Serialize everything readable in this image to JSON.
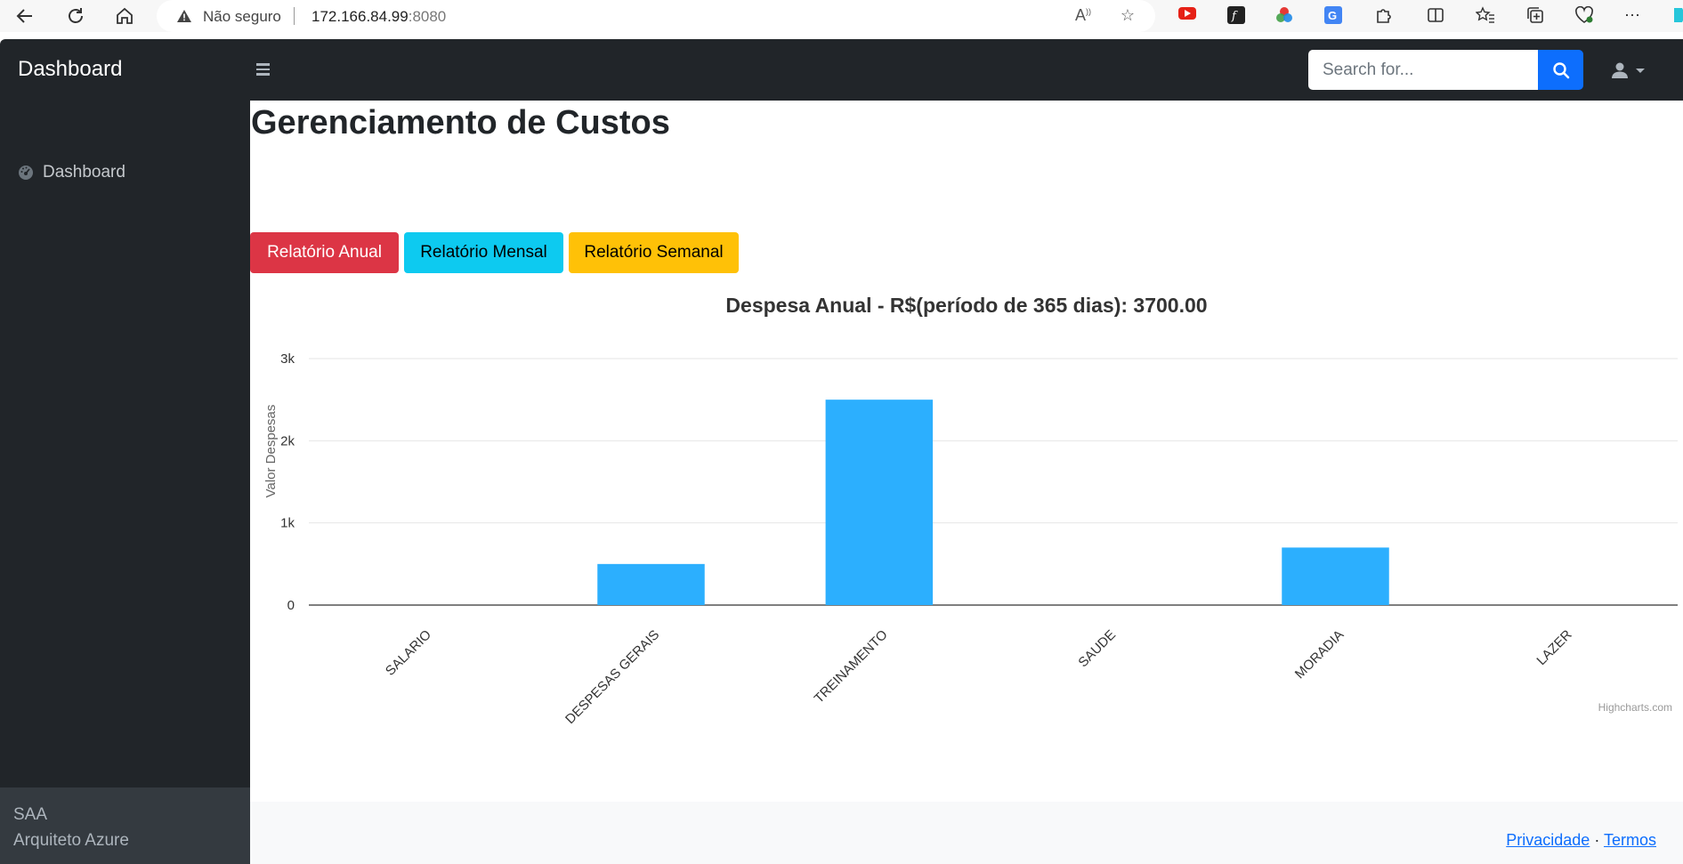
{
  "browser": {
    "security_label": "Não seguro",
    "url_host": "172.166.84.99",
    "url_port": ":8080"
  },
  "navbar": {
    "brand": "Dashboard",
    "search_placeholder": "Search for..."
  },
  "sidebar": {
    "items": [
      {
        "label": "Dashboard"
      }
    ],
    "footer_line1": "SAA",
    "footer_line2": "Arquiteto Azure"
  },
  "main": {
    "title": "Gerenciamento de Custos",
    "buttons": {
      "anual": "Relatório Anual",
      "mensal": "Relatório Mensal",
      "semanal": "Relatório Semanal"
    },
    "credits": "Highcharts.com"
  },
  "footer": {
    "privacy": "Privacidade",
    "separator": " · ",
    "terms": "Termos"
  },
  "colors": {
    "bar": "#2caffe",
    "navbar": "#212529",
    "primary": "#0d6efd"
  },
  "chart_data": {
    "type": "bar",
    "title": "Despesa Anual - R$(período de 365 dias): 3700.00",
    "ylabel": "Valor Despesas",
    "xlabel": "",
    "categories": [
      "SALARIO",
      "DESPESAS GERAIS",
      "TREINAMENTO",
      "SAUDE",
      "MORADIA",
      "LAZER"
    ],
    "values": [
      0,
      500,
      2500,
      0,
      700,
      0
    ],
    "ylim": [
      0,
      3000
    ],
    "yticks": [
      "0",
      "1k",
      "2k",
      "3k"
    ],
    "ytick_values": [
      0,
      1000,
      2000,
      3000
    ],
    "grid": true,
    "legend": "none"
  }
}
